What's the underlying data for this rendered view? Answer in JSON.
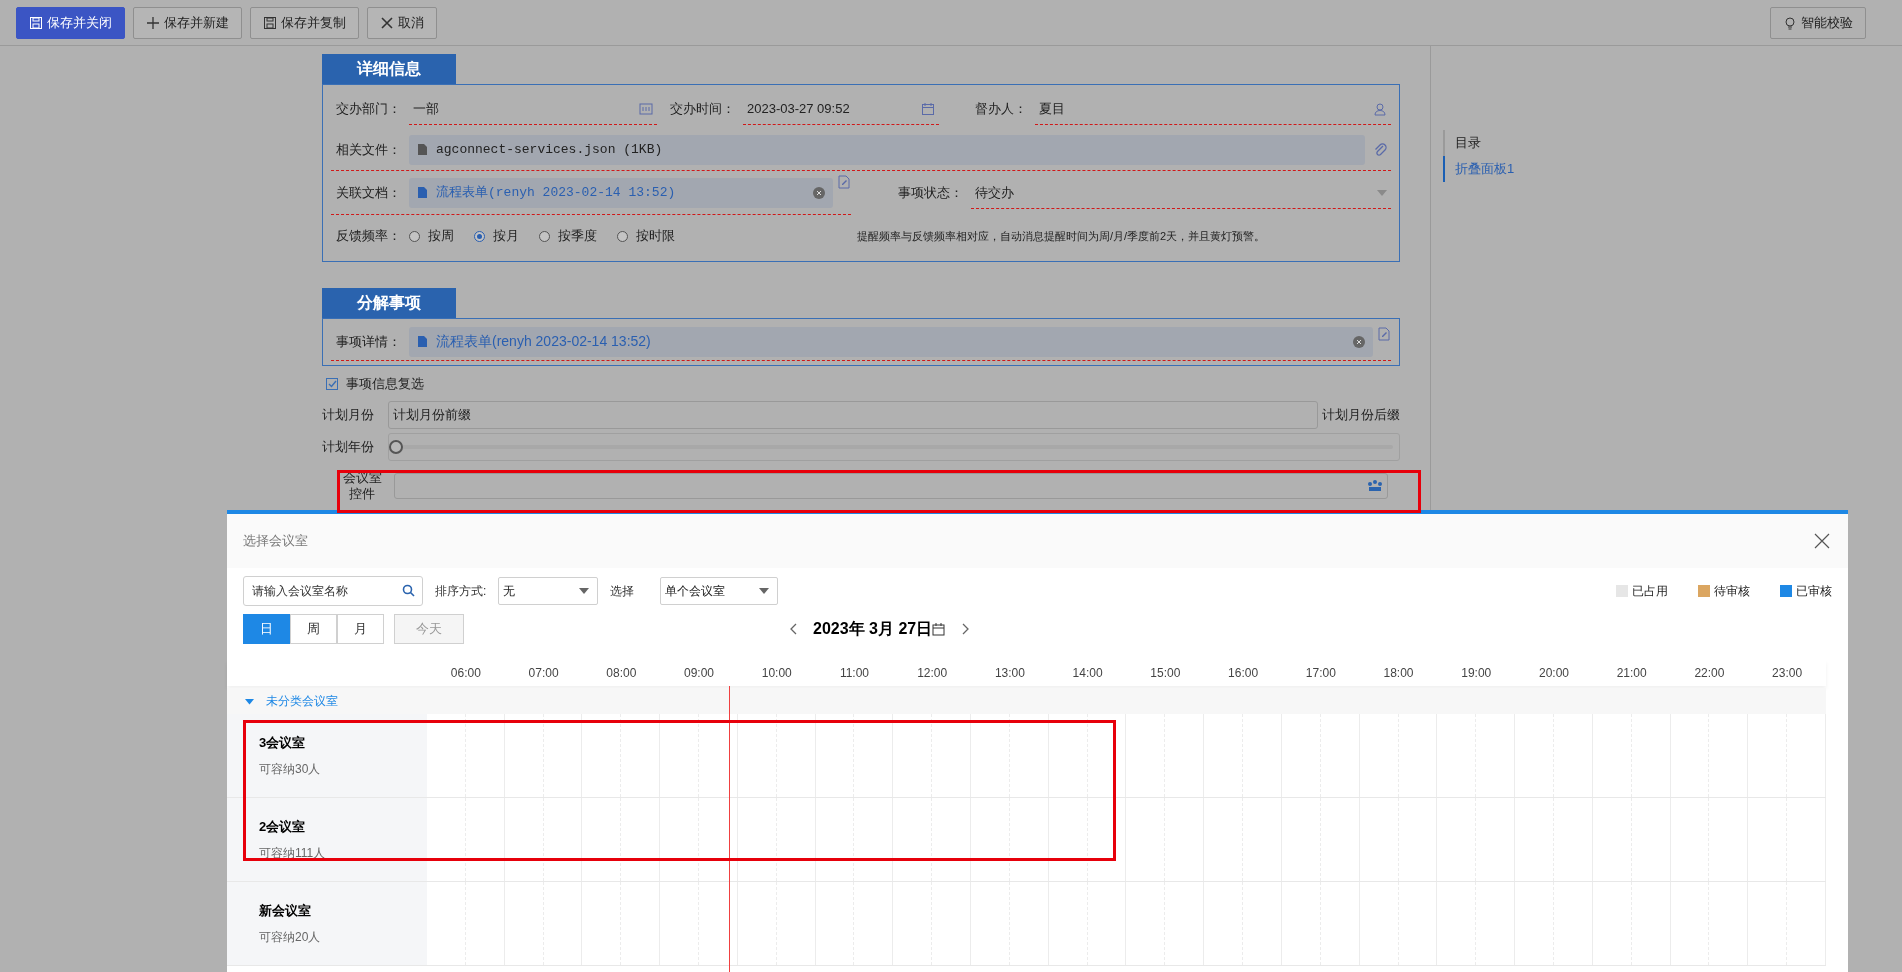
{
  "toolbar": {
    "buttons": [
      {
        "label": "保存并关闭",
        "kind": "primary"
      },
      {
        "label": "保存并新建",
        "kind": "new"
      },
      {
        "label": "保存并复制",
        "kind": "copy"
      },
      {
        "label": "取消",
        "kind": "cancel"
      }
    ],
    "smart_check": "智能校验"
  },
  "detail_section": {
    "title": "详细信息",
    "department": {
      "label": "交办部门：",
      "value": "一部"
    },
    "assign_time": {
      "label": "交办时间：",
      "value": "2023-03-27 09:52"
    },
    "supervisor": {
      "label": "督办人：",
      "value": "夏目"
    },
    "related_files": {
      "label": "相关文件：",
      "file": "agconnect-services.json (1KB)"
    },
    "linked_doc": {
      "label": "关联文档：",
      "link": "流程表单(renyh 2023-02-14 13:52)"
    },
    "status": {
      "label": "事项状态：",
      "value": "待交办"
    },
    "feedback": {
      "label": "反馈频率：",
      "options": [
        {
          "label": "按周",
          "selected": false
        },
        {
          "label": "按月",
          "selected": true
        },
        {
          "label": "按季度",
          "selected": false
        },
        {
          "label": "按时限",
          "selected": false
        }
      ]
    },
    "hint": "提醒频率与反馈频率相对应，自动消息提醒时间为周/月/季度前2天，并且黄灯预警。"
  },
  "split_section": {
    "title": "分解事项",
    "detail": {
      "label": "事项详情：",
      "link": "流程表单(renyh 2023-02-14 13:52)"
    }
  },
  "multi_check": {
    "label": "事项信息复选",
    "checked": true
  },
  "plan_month": {
    "label": "计划月份",
    "value": "计划月份前缀",
    "suffix": "计划月份后缀"
  },
  "plan_year": {
    "label": "计划年份",
    "level": 0
  },
  "room_control": {
    "label": "会议室控件"
  },
  "toc": {
    "items": [
      {
        "label": "目录",
        "selected": false
      },
      {
        "label": "折叠面板1",
        "selected": true
      }
    ]
  },
  "dialog": {
    "title": "选择会议室",
    "search": {
      "placeholder": "请输入会议室名称"
    },
    "sort": {
      "label": "排序方式:",
      "value": "无"
    },
    "select": {
      "label": "选择",
      "value": "单个会议室"
    },
    "legend": [
      {
        "label": "已占用",
        "color": "#e6e6e6"
      },
      {
        "label": "待审核",
        "color": "#dba661"
      },
      {
        "label": "已审核",
        "color": "#1e88e5"
      }
    ],
    "views": [
      {
        "label": "日",
        "selected": true
      },
      {
        "label": "周",
        "selected": false
      },
      {
        "label": "月",
        "selected": false
      }
    ],
    "today": "今天",
    "date": "2023年 3月 27日",
    "hours": [
      "06:00",
      "07:00",
      "08:00",
      "09:00",
      "10:00",
      "11:00",
      "12:00",
      "13:00",
      "14:00",
      "15:00",
      "16:00",
      "17:00",
      "18:00",
      "19:00",
      "20:00",
      "21:00",
      "22:00",
      "23:00"
    ],
    "group": {
      "label": "未分类会议室",
      "expanded": true,
      "rooms": [
        {
          "name": "3会议室",
          "capacity": "可容纳30人"
        },
        {
          "name": "2会议室",
          "capacity": "可容纳111人"
        },
        {
          "name": "新会议室",
          "capacity": "可容纳20人"
        }
      ]
    }
  }
}
